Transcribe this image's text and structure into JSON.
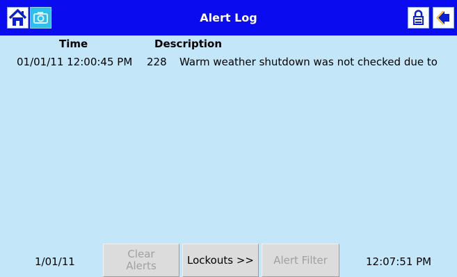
{
  "header": {
    "title": "Alert Log",
    "icons": [
      "home-icon",
      "camera-icon",
      "lock-icon",
      "back-arrow-icon"
    ]
  },
  "table": {
    "columns": [
      "Time",
      "Description"
    ],
    "rows": [
      {
        "time": "01/01/11 12:00:45 PM",
        "code": "228",
        "description": "Warm weather shutdown was not checked due to"
      }
    ]
  },
  "footer": {
    "date": "1/01/11",
    "time": "12:07:51 PM",
    "clear_alerts_line1": "Clear",
    "clear_alerts_line2": "Alerts",
    "lockouts_label": "Lockouts >>",
    "alert_filter_label": "Alert Filter"
  },
  "colors": {
    "titlebar": "#0b0bef",
    "background": "#c3e6f8",
    "disabled_text": "#a0a0a0"
  }
}
